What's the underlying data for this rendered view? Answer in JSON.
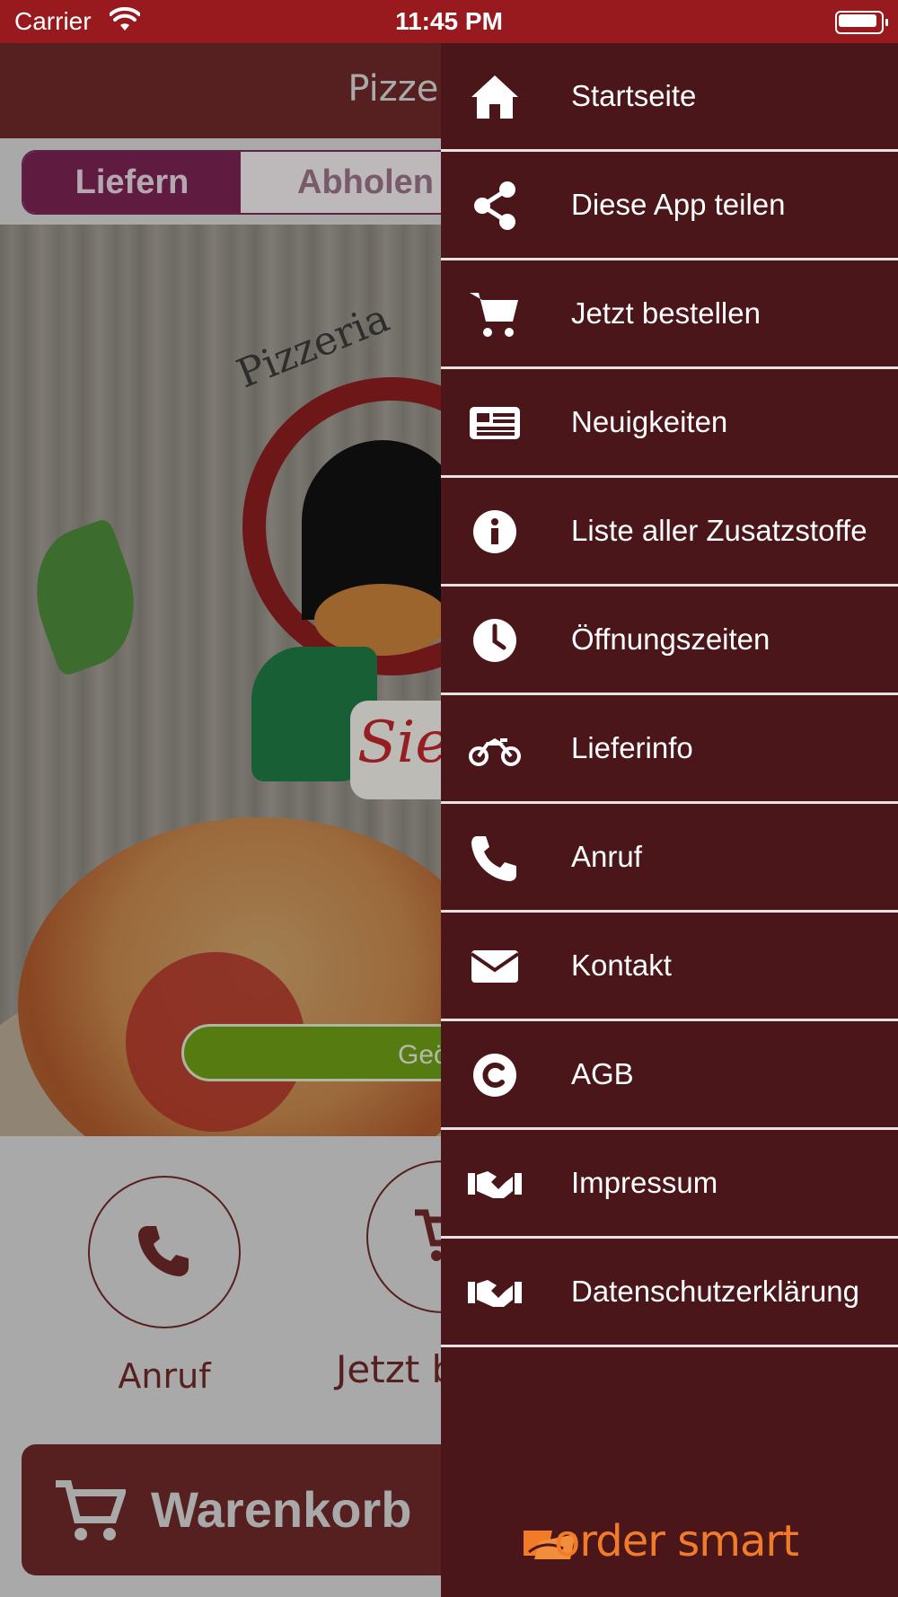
{
  "status_bar": {
    "carrier": "Carrier",
    "time": "11:45 PM"
  },
  "app": {
    "title": "Pizzeria Tra",
    "mode_tabs": [
      {
        "label": "Liefern"
      },
      {
        "label": "Abholen"
      }
    ],
    "hero": {
      "logo_text": "Pizzeria",
      "badge_text": "Sie",
      "open_button_label": "Geö"
    },
    "quick_actions": [
      {
        "label": "Anruf",
        "icon": "phone-icon"
      },
      {
        "label": "Jetzt b",
        "icon": "cart-icon"
      }
    ],
    "cart_button_label": "Warenkorb"
  },
  "drawer": {
    "items": [
      {
        "label": "Startseite",
        "icon": "home-icon"
      },
      {
        "label": "Diese App teilen",
        "icon": "share-icon"
      },
      {
        "label": "Jetzt bestellen",
        "icon": "cart-icon"
      },
      {
        "label": "Neuigkeiten",
        "icon": "newspaper-icon"
      },
      {
        "label": "Liste aller Zusatzstoffe",
        "icon": "info-icon"
      },
      {
        "label": "Öffnungszeiten",
        "icon": "clock-icon"
      },
      {
        "label": "Lieferinfo",
        "icon": "motorcycle-icon"
      },
      {
        "label": "Anruf",
        "icon": "phone-icon"
      },
      {
        "label": "Kontakt",
        "icon": "envelope-icon"
      },
      {
        "label": "AGB",
        "icon": "copyright-icon"
      },
      {
        "label": "Impressum",
        "icon": "handshake-icon"
      },
      {
        "label": "Datenschutzerklärung",
        "icon": "handshake-icon"
      }
    ],
    "brand": "order smart"
  },
  "colors": {
    "status_bar": "#98191e",
    "drawer_bg": "#4a161a",
    "brand_orange": "#f07c29",
    "accent": "#7a2452",
    "open_green": "#6f9e16"
  }
}
